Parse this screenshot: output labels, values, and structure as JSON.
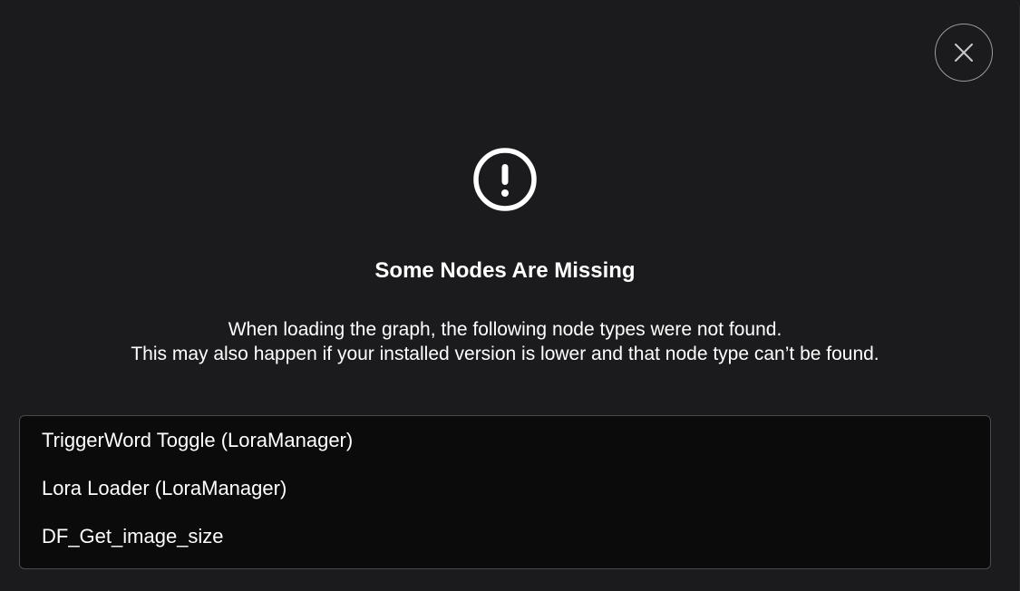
{
  "dialog": {
    "title": "Some Nodes Are Missing",
    "message_line1": "When loading the graph, the following node types were not found.",
    "message_line2": "This may also happen if your installed version is lower and that node type can’t be found.",
    "close_icon": "close-icon",
    "alert_icon": "alert-circle-icon",
    "missing_nodes": [
      "TriggerWord Toggle (LoraManager)",
      "Lora Loader (LoraManager)",
      "DF_Get_image_size"
    ]
  }
}
